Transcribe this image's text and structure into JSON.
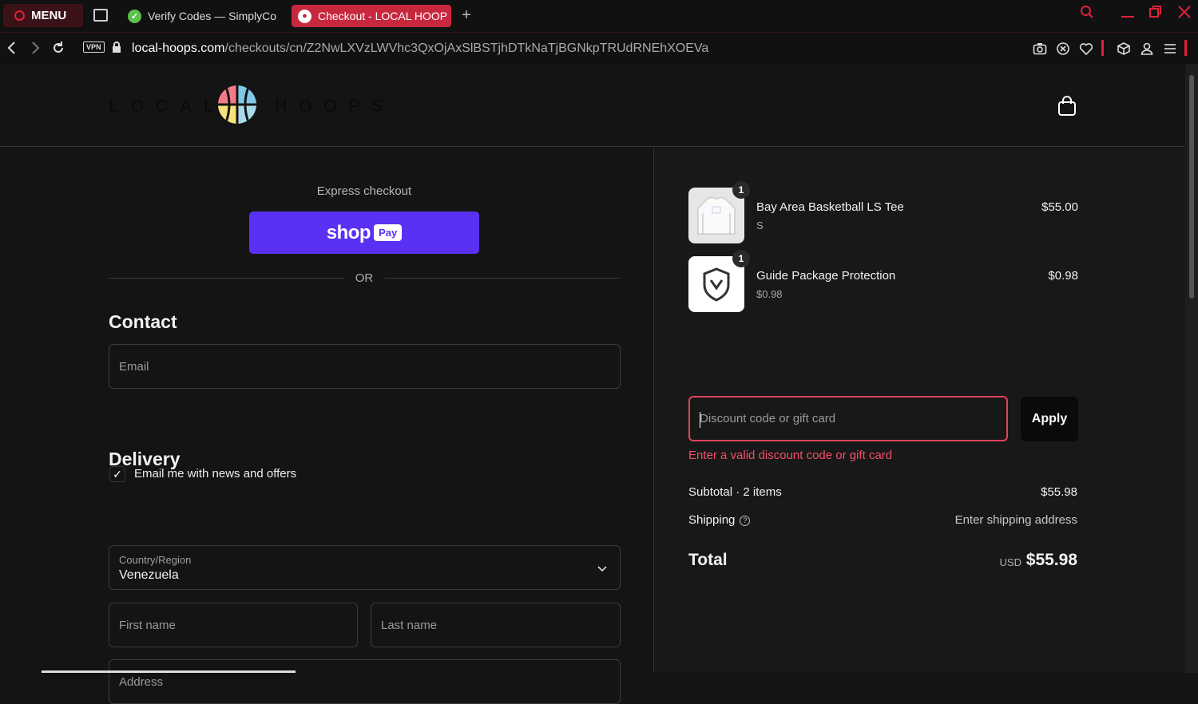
{
  "browser": {
    "menu_label": "MENU",
    "tabs": [
      {
        "title": "Verify Codes — SimplyCo"
      },
      {
        "title": "Checkout - LOCAL HOOP"
      }
    ],
    "vpn_label": "VPN",
    "url_host": "local-hoops.com",
    "url_path": "/checkouts/cn/Z2NwLXVzLWVhc3QxOjAxSlBSTjhDTkNaTjBGNkpTRUdRNEhXOEVa",
    "accent_color": "#e0203a"
  },
  "store": {
    "logo_left": "LOCAL",
    "logo_right": "HOOPS"
  },
  "checkout": {
    "express_label": "Express checkout",
    "shoppay_word": "shop",
    "shoppay_badge": "Pay",
    "or_label": "OR",
    "contact": {
      "title": "Contact",
      "email_placeholder": "Email",
      "newsletter_label": "Email me with news and offers",
      "newsletter_checked": true
    },
    "delivery": {
      "title": "Delivery",
      "country_label": "Country/Region",
      "country_value": "Venezuela",
      "first_name_placeholder": "First name",
      "last_name_placeholder": "Last name",
      "address_placeholder": "Address"
    }
  },
  "summary": {
    "items": [
      {
        "qty": "1",
        "name": "Bay Area Basketball LS Tee",
        "variant": "S",
        "price": "$55.00"
      },
      {
        "qty": "1",
        "name": "Guide Package Protection",
        "variant": "$0.98",
        "price": "$0.98"
      }
    ],
    "discount_placeholder": "Discount code or gift card",
    "apply_label": "Apply",
    "discount_error": "Enter a valid discount code or gift card",
    "subtotal_label": "Subtotal · 2 items",
    "subtotal_value": "$55.98",
    "shipping_label": "Shipping",
    "shipping_value": "Enter shipping address",
    "total_label": "Total",
    "total_currency": "USD",
    "total_value": "$55.98"
  }
}
